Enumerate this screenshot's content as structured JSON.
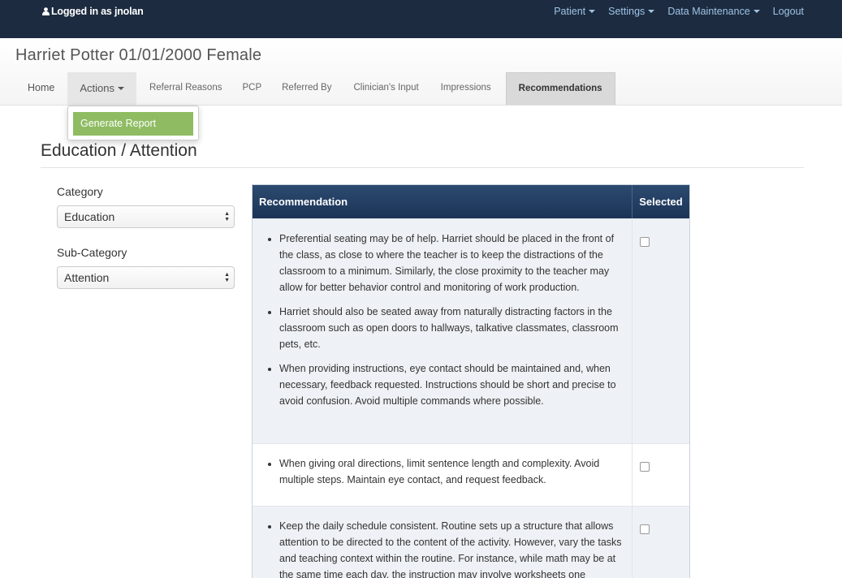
{
  "topbar": {
    "user_text": "Logged in as jnolan",
    "nav": [
      {
        "label": "Patient",
        "dropdown": true
      },
      {
        "label": "Settings",
        "dropdown": true
      },
      {
        "label": "Data Maintenance",
        "dropdown": true
      },
      {
        "label": "Logout",
        "dropdown": false
      }
    ]
  },
  "patient": {
    "title": "Harriet Potter 01/01/2000 Female"
  },
  "tabs": {
    "home": "Home",
    "actions": "Actions",
    "referral_reasons": "Referral Reasons",
    "pcp": "PCP",
    "referred_by": "Referred By",
    "clinicians_input": "Clinician's Input",
    "impressions": "Impressions",
    "recommendations": "Recommendations"
  },
  "actions_menu": {
    "generate_report": "Generate Report"
  },
  "section": {
    "title": "Education / Attention"
  },
  "filters": {
    "category_label": "Category",
    "category_value": "Education",
    "subcategory_label": "Sub-Category",
    "subcategory_value": "Attention"
  },
  "table": {
    "col_recommendation": "Recommendation",
    "col_selected": "Selected",
    "rows": [
      {
        "items": [
          "Preferential seating may be of help. Harriet should be placed in the front of the class, as close to where the teacher is to keep the distractions of the classroom to a minimum. Similarly, the close proximity to the teacher may allow for better behavior control and monitoring of work production.",
          "Harriet should also be seated away from naturally distracting factors in the classroom such as open doors to hallways, talkative classmates, classroom pets, etc.",
          "When providing instructions, eye contact should be maintained and, when necessary, feedback requested. Instructions should be short and precise to avoid confusion. Avoid multiple commands where possible."
        ],
        "selected": false
      },
      {
        "items": [
          "When giving oral directions, limit sentence length and complexity. Avoid multiple steps. Maintain eye contact, and request feedback."
        ],
        "selected": false
      },
      {
        "items": [
          "Keep the daily schedule consistent. Routine sets up a structure that allows attention to be directed to the content of the activity. However, vary the tasks and teaching context within the routine. For instance, while math may be at the same time each day, the instruction may involve worksheets one"
        ],
        "selected": false
      }
    ]
  },
  "colors": {
    "topbar_bg": "#1c2b3f",
    "nav_link": "#9ec3e6",
    "table_header": "#1f3a5f",
    "generate_button": "#8fbc62"
  }
}
